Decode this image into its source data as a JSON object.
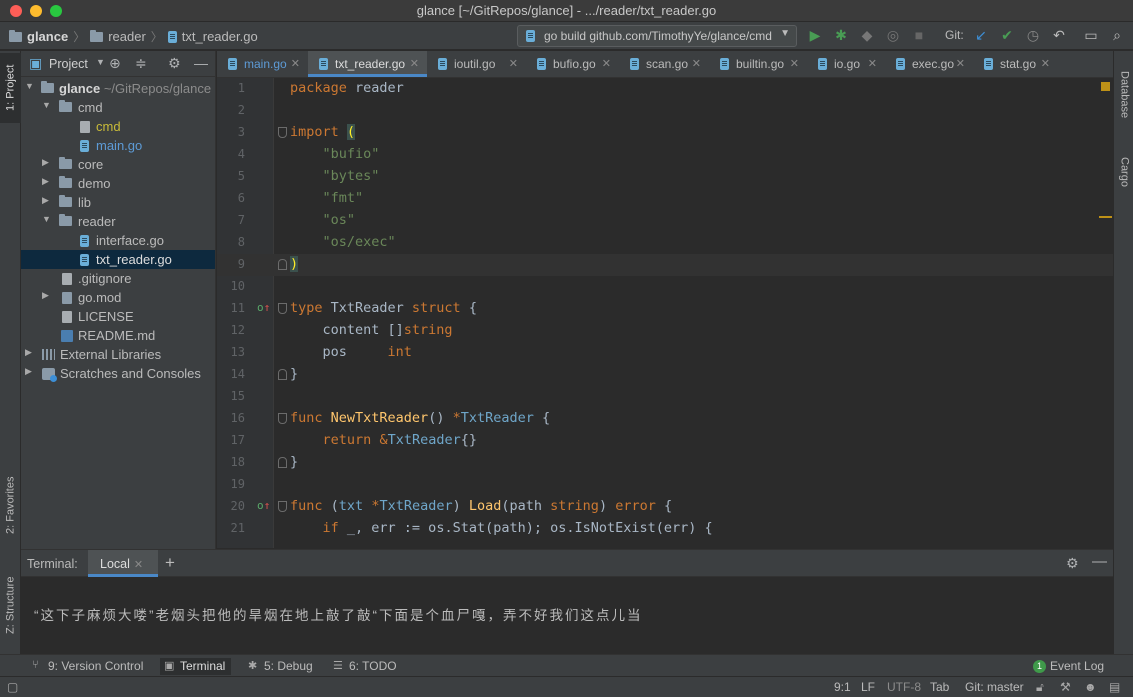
{
  "window": {
    "title": "glance [~/GitRepos/glance] - .../reader/txt_reader.go"
  },
  "breadcrumb": [
    "glance",
    "reader",
    "txt_reader.go"
  ],
  "run_config": "go build github.com/TimothyYe/glance/cmd",
  "git_label": "Git:",
  "left_tool_tabs": [
    "1: Project",
    "2: Favorites",
    "Z: Structure"
  ],
  "right_tool_tabs": [
    "Database",
    "Cargo"
  ],
  "project_panel": {
    "title": "Project",
    "tree": [
      {
        "label": "glance",
        "extra": "~/GitRepos/glance"
      },
      {
        "label": "cmd"
      },
      {
        "label": "cmd"
      },
      {
        "label": "main.go"
      },
      {
        "label": "core"
      },
      {
        "label": "demo"
      },
      {
        "label": "lib"
      },
      {
        "label": "reader"
      },
      {
        "label": "interface.go"
      },
      {
        "label": "txt_reader.go"
      },
      {
        "label": ".gitignore"
      },
      {
        "label": "go.mod"
      },
      {
        "label": "LICENSE"
      },
      {
        "label": "README.md"
      },
      {
        "label": "External Libraries"
      },
      {
        "label": "Scratches and Consoles"
      }
    ]
  },
  "editor_tabs": [
    "main.go",
    "txt_reader.go",
    "ioutil.go",
    "bufio.go",
    "scan.go",
    "builtin.go",
    "io.go",
    "exec.go",
    "stat.go"
  ],
  "active_tab": "txt_reader.go",
  "code": {
    "line_numbers": [
      "1",
      "2",
      "3",
      "4",
      "5",
      "6",
      "7",
      "8",
      "9",
      "10",
      "11",
      "12",
      "13",
      "14",
      "15",
      "16",
      "17",
      "18",
      "19",
      "20",
      "21"
    ],
    "lines": [
      "package reader",
      "",
      "import (",
      "    \"bufio\"",
      "    \"bytes\"",
      "    \"fmt\"",
      "    \"os\"",
      "    \"os/exec\"",
      ")",
      "",
      "type TxtReader struct {",
      "    content []string",
      "    pos     int",
      "}",
      "",
      "func NewTxtReader() *TxtReader {",
      "    return &TxtReader{}",
      "}",
      "",
      "func (txt *TxtReader) Load(path string) error {",
      "    if _, err := os.Stat(path); os.IsNotExist(err) {"
    ]
  },
  "terminal": {
    "label": "Terminal:",
    "tab": "Local",
    "text": "“这下子麻烦大喽”老烟头把他的旱烟在地上敲了敲“下面是个血尸嘎，弄不好我们这点儿当"
  },
  "bottom_tools": [
    {
      "label": "9: Version Control"
    },
    {
      "label": "Terminal"
    },
    {
      "label": "5: Debug"
    },
    {
      "label": "6: TODO"
    }
  ],
  "event_log": {
    "count": "1",
    "label": "Event Log"
  },
  "status": {
    "position": "9:1",
    "line_sep": "LF",
    "encoding": "UTF-8",
    "indent": "Tab",
    "git_branch": "Git: master"
  }
}
